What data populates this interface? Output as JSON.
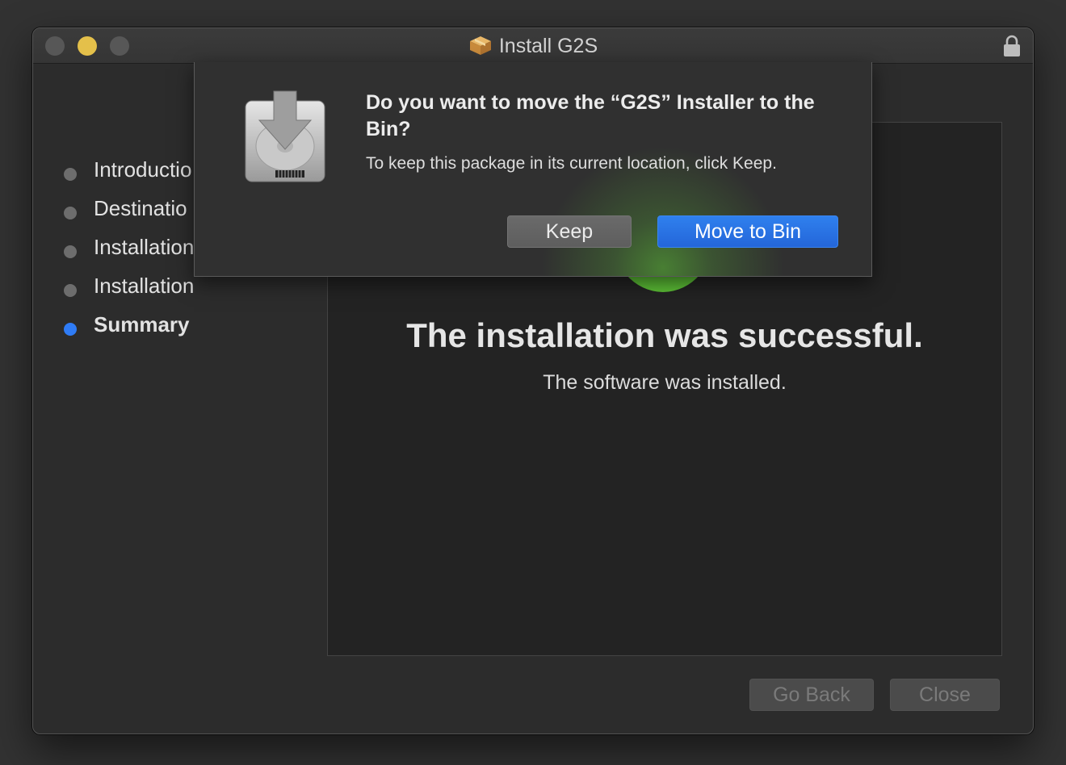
{
  "window": {
    "title": "Install G2S",
    "title_icon": "package-icon",
    "lock_icon": "lock-icon"
  },
  "sidebar": {
    "items": [
      {
        "label": "Introductio",
        "active": false
      },
      {
        "label": "Destinatio",
        "active": false
      },
      {
        "label": "Installation",
        "active": false
      },
      {
        "label": "Installation",
        "active": false
      },
      {
        "label": "Summary",
        "active": true
      }
    ]
  },
  "main": {
    "title": "The installation was successful.",
    "subtitle": "The software was installed."
  },
  "dialog": {
    "title": "Do you want to move the “G2S” Installer to the Bin?",
    "message": "To keep this package in its current location, click Keep.",
    "keep_label": "Keep",
    "move_label": "Move to Bin"
  },
  "buttons": {
    "go_back": "Go Back",
    "close": "Close"
  },
  "colors": {
    "accent": "#2f7cf6",
    "success": "#5cbf36",
    "traffic_min": "#e4c04a"
  }
}
